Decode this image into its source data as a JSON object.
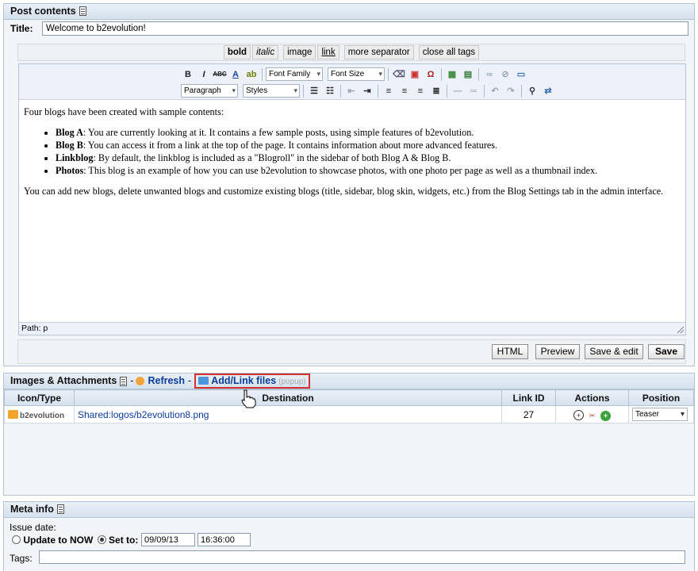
{
  "post_panel": {
    "heading": "Post contents",
    "title_label": "Title:",
    "title_value": "Welcome to b2evolution!",
    "quicktags": [
      "bold",
      "italic",
      "image",
      "link",
      "more separator",
      "close all tags"
    ],
    "toolbar": {
      "font_family": "Font Family",
      "font_size": "Font Size",
      "format": "Paragraph",
      "styles": "Styles"
    },
    "content": {
      "intro": "Four blogs have been created with sample contents:",
      "items": [
        {
          "term": "Blog A",
          "text": ": You are currently looking at it. It contains a few sample posts, using simple features of b2evolution."
        },
        {
          "term": "Blog B",
          "text": ": You can access it from a link at the top of the page. It contains information about more advanced features."
        },
        {
          "term": "Linkblog",
          "text": ": By default, the linkblog is included as a \"Blogroll\" in the sidebar of both Blog A & Blog B."
        },
        {
          "term": "Photos",
          "text": ": This blog is an example of how you can use b2evolution to showcase photos, with one photo per page as well as a thumbnail index."
        }
      ],
      "outro": "You can add new blogs, delete unwanted blogs and customize existing blogs (title, sidebar, blog skin, widgets, etc.) from the Blog Settings tab in the admin interface."
    },
    "path": "Path: p",
    "buttons": {
      "html": "HTML",
      "preview": "Preview",
      "save_edit": "Save & edit",
      "save": "Save"
    }
  },
  "attachments": {
    "heading": "Images & Attachments",
    "refresh": "Refresh",
    "add_link": "Add/Link files",
    "popup": "(popup)",
    "columns": [
      "Icon/Type",
      "Destination",
      "Link ID",
      "Actions",
      "Position"
    ],
    "rows": [
      {
        "icon_label": "b2evolution",
        "destination": "Shared:logos/b2evolution8.png",
        "link_id": "27",
        "position": "Teaser"
      }
    ]
  },
  "meta": {
    "heading": "Meta info",
    "issue_date_label": "Issue date:",
    "update_now": "Update to NOW",
    "set_to": "Set to:",
    "date": "09/09/13",
    "time": "16:36:00",
    "tags_label": "Tags:",
    "tags_value": ""
  },
  "colors": {
    "link": "#0b3c9b",
    "highlight_border": "#d2312f",
    "panel_border": "#b4c3d4"
  }
}
